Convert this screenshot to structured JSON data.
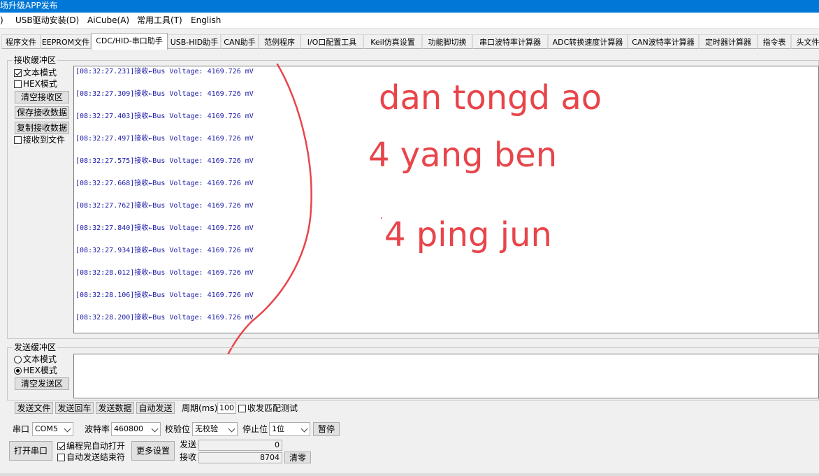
{
  "window": {
    "title": "场升级APP发布"
  },
  "menu": [
    {
      "label": ")"
    },
    {
      "label": "USB驱动安装(D)"
    },
    {
      "label": "AiCube(A)"
    },
    {
      "label": "常用工具(T)"
    },
    {
      "label": "English"
    }
  ],
  "tabs": [
    {
      "label": "程序文件"
    },
    {
      "label": "EEPROM文件"
    },
    {
      "label": "CDC/HID-串口助手"
    },
    {
      "label": "USB-HID助手"
    },
    {
      "label": "CAN助手"
    },
    {
      "label": "范例程序"
    },
    {
      "label": "I/O口配置工具"
    },
    {
      "label": "Keil仿真设置"
    },
    {
      "label": "功能脚切换"
    },
    {
      "label": "串口波特率计算器"
    },
    {
      "label": "ADC转换速度计算器"
    },
    {
      "label": "CAN波特率计算器"
    },
    {
      "label": "定时器计算器"
    },
    {
      "label": "指令表"
    },
    {
      "label": "头文件"
    }
  ],
  "receive": {
    "title": "接收缓冲区",
    "text_mode": "文本模式",
    "hex_mode": "HEX模式",
    "clear_btn": "清空接收区",
    "save_btn": "保存接收数据",
    "copy_btn": "复制接收数据",
    "to_file": "接收到文件",
    "text_mode_checked": true,
    "hex_mode_checked": false,
    "to_file_checked": false,
    "lines": [
      "[08:32:27.231]接收←Bus Voltage: 4169.726 mV",
      "[08:32:27.309]接收←Bus Voltage: 4169.726 mV",
      "[08:32:27.403]接收←Bus Voltage: 4169.726 mV",
      "[08:32:27.497]接收←Bus Voltage: 4169.726 mV",
      "[08:32:27.575]接收←Bus Voltage: 4169.726 mV",
      "[08:32:27.668]接收←Bus Voltage: 4169.726 mV",
      "[08:32:27.762]接收←Bus Voltage: 4169.726 mV",
      "[08:32:27.840]接收←Bus Voltage: 4169.726 mV",
      "[08:32:27.934]接收←Bus Voltage: 4169.726 mV",
      "[08:32:28.012]接收←Bus Voltage: 4169.726 mV",
      "[08:32:28.106]接收←Bus Voltage: 4169.726 mV",
      "[08:32:28.200]接收←Bus Voltage: 4169.726 mV"
    ]
  },
  "annotations": [
    "dan tongd ao",
    "4 yang ben",
    "4 ping jun"
  ],
  "send": {
    "title": "发送缓冲区",
    "text_mode": "文本模式",
    "hex_mode": "HEX模式",
    "clear_btn": "清空发送区",
    "selected_mode": "hex"
  },
  "send_toolbar": {
    "send_file": "发送文件",
    "send_enter": "发送回车",
    "send_data": "发送数据",
    "auto_send": "自动发送",
    "period_label": "周期(ms)",
    "period_value": "100",
    "match_test": "收发匹配测试",
    "match_test_checked": false
  },
  "port": {
    "port_label": "串口",
    "port_value": "COM5",
    "baud_label": "波特率",
    "baud_value": "460800",
    "parity_label": "校验位",
    "parity_value": "无校验",
    "stop_label": "停止位",
    "stop_value": "1位",
    "pause_btn": "暂停",
    "open_btn": "打开串口",
    "auto_open": "编程完自动打开",
    "auto_open_checked": true,
    "auto_end": "自动发送结束符",
    "auto_end_checked": false,
    "more_btn": "更多设置",
    "send_label": "发送",
    "send_count": "0",
    "recv_label": "接收",
    "recv_count": "8704",
    "clear_btn": "清零"
  },
  "colors": {
    "titlebar": "#0078d7",
    "log_text": "#1a1aa6",
    "annotation": "#e8454b"
  }
}
